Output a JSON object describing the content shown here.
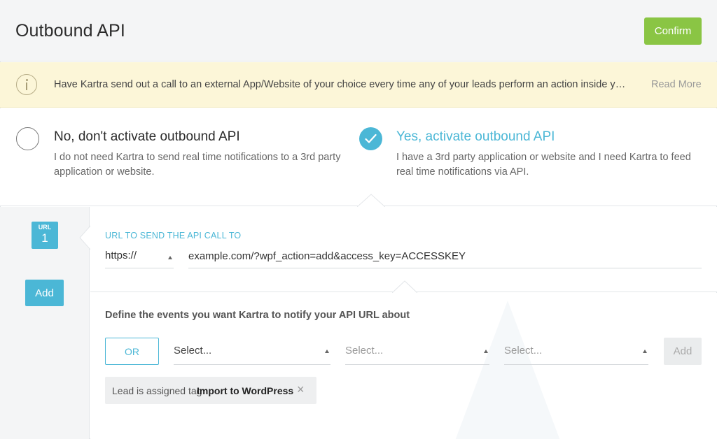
{
  "header": {
    "title": "Outbound API",
    "confirm_label": "Confirm"
  },
  "banner": {
    "icon": "info-icon",
    "text": "Have Kartra send out a call to an external App/Website of your choice every time any of your leads perform an action inside yo...",
    "read_more": "Read More"
  },
  "options": {
    "no": {
      "title": "No, don't activate outbound API",
      "description": "I do not need Kartra to send real time notifications to a 3rd party application or website.",
      "selected": false
    },
    "yes": {
      "title": "Yes, activate outbound API",
      "description": "I have a 3rd party application or website and I need Kartra to feed real time notifications via API.",
      "selected": true
    }
  },
  "sidebar": {
    "url_badge_label": "URL",
    "url_badge_number": "1",
    "add_label": "Add"
  },
  "url_section": {
    "label": "URL TO SEND THE API CALL TO",
    "protocol": "https://",
    "url_value": "example.com/?wpf_action=add&access_key=ACCESSKEY"
  },
  "events": {
    "heading": "Define the events you want Kartra to notify your API URL about",
    "or_label": "OR",
    "select1": "Select...",
    "select2": "Select...",
    "select3": "Select...",
    "add_label": "Add",
    "tag": {
      "prefix": "Lead is assigned tag",
      "name": "Import to WordPress",
      "remove": "×"
    }
  },
  "colors": {
    "accent": "#4bb7d6",
    "confirm": "#8ac544",
    "banner": "#fcf6d8"
  }
}
